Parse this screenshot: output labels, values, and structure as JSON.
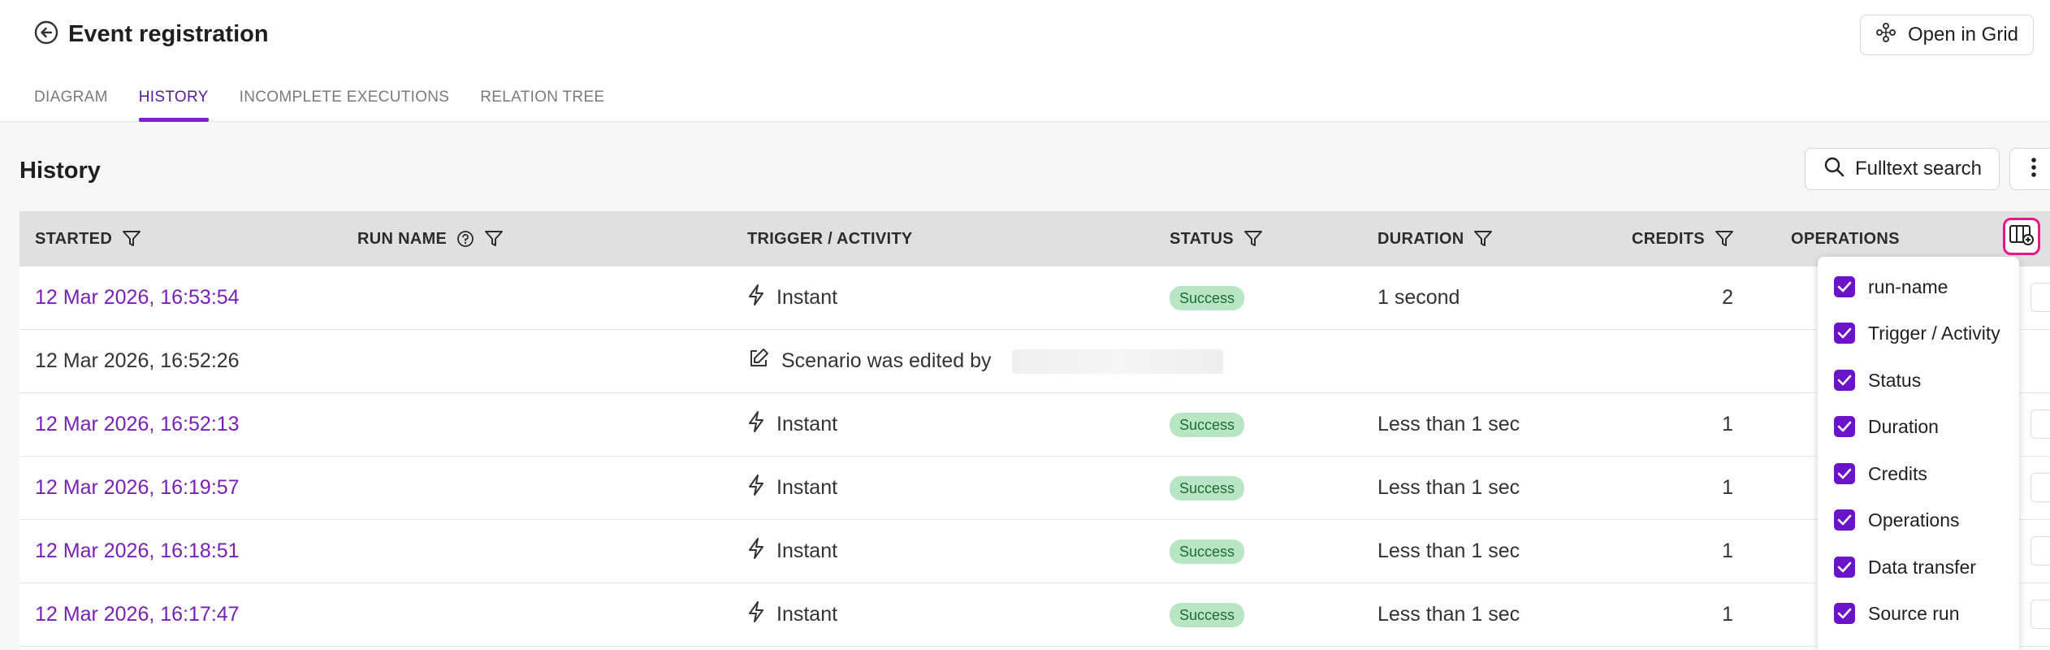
{
  "header": {
    "title": "Event registration",
    "open_grid_label": "Open in Grid"
  },
  "tabs": [
    {
      "label": "DIAGRAM",
      "active": false
    },
    {
      "label": "HISTORY",
      "active": true
    },
    {
      "label": "INCOMPLETE EXECUTIONS",
      "active": false
    },
    {
      "label": "RELATION TREE",
      "active": false
    }
  ],
  "history": {
    "title": "History",
    "search_label": "Fulltext search"
  },
  "table": {
    "columns": {
      "started": "STARTED",
      "run_name": "RUN NAME",
      "trigger": "TRIGGER / ACTIVITY",
      "status": "STATUS",
      "duration": "DURATION",
      "credits": "CREDITS",
      "operations": "OPERATIONS"
    },
    "rows": [
      {
        "started": "12 Mar 2026, 16:53:54",
        "trigger": "Instant",
        "status": "Success",
        "duration": "1 second",
        "credits": "2"
      },
      {
        "started": "12 Mar 2026, 16:52:26",
        "trigger": "Scenario was edited by",
        "status": "",
        "duration": "",
        "credits": ""
      },
      {
        "started": "12 Mar 2026, 16:52:13",
        "trigger": "Instant",
        "status": "Success",
        "duration": "Less than 1 sec",
        "credits": "1"
      },
      {
        "started": "12 Mar 2026, 16:19:57",
        "trigger": "Instant",
        "status": "Success",
        "duration": "Less than 1 sec",
        "credits": "1"
      },
      {
        "started": "12 Mar 2026, 16:18:51",
        "trigger": "Instant",
        "status": "Success",
        "duration": "Less than 1 sec",
        "credits": "1"
      },
      {
        "started": "12 Mar 2026, 16:17:47",
        "trigger": "Instant",
        "status": "Success",
        "duration": "Less than 1 sec",
        "credits": "1"
      }
    ]
  },
  "column_menu": {
    "items": [
      {
        "label": "run-name",
        "checked": true
      },
      {
        "label": "Trigger / Activity",
        "checked": true
      },
      {
        "label": "Status",
        "checked": true
      },
      {
        "label": "Duration",
        "checked": true
      },
      {
        "label": "Credits",
        "checked": true
      },
      {
        "label": "Operations",
        "checked": true
      },
      {
        "label": "Data transfer",
        "checked": true
      },
      {
        "label": "Source run",
        "checked": true
      }
    ]
  },
  "colors": {
    "accent": "#7a1fd1",
    "link": "#7a1fb8",
    "success_bg": "#b8e6c4",
    "success_text": "#1e6b34",
    "highlight": "#e6198a"
  }
}
